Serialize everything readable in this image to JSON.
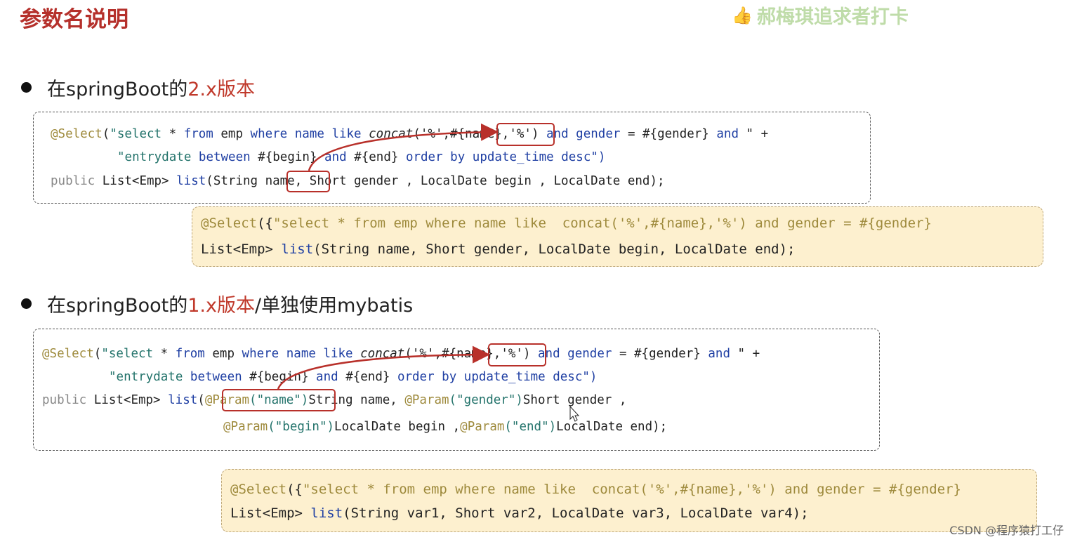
{
  "title": "参数名说明",
  "watermark": "郝梅琪追求者打卡",
  "bullet1": {
    "prefix": "在springBoot的",
    "highlight": "2.x版本",
    "suffix": ""
  },
  "bullet2": {
    "prefix": "在springBoot的",
    "highlight": "1.x版本",
    "suffix": "/单独使用mybatis"
  },
  "code1": {
    "l1": {
      "a": "@Select",
      "b": "(",
      "c": "\"select ",
      "d": "* ",
      "e": "from ",
      "f": "emp ",
      "g": "where ",
      "h": "name ",
      "i": "like ",
      "j": "concat",
      "k": "('%',",
      "l": "#{name}",
      "m": ",'%') ",
      "n": "and ",
      "o": "gender ",
      "p": "= #{gender} ",
      "q": "and ",
      "r": "\" +"
    },
    "l2": {
      "a": "\"entrydate ",
      "b": "between ",
      "c": "#{begin} ",
      "d": "and ",
      "e": "#{end} ",
      "f": "order by ",
      "g": "update_time ",
      "h": "desc\")"
    },
    "l3": {
      "a": "public ",
      "b": "List<Emp> ",
      "c": "list",
      "d": "(String ",
      "e": "name,",
      "f": " Short gender , LocalDate begin , LocalDate end);"
    }
  },
  "ycode1": {
    "l1": {
      "a": "@Select",
      "b": "({",
      "c": "\"select * from emp where name like  concat('%',#{name},'%') and gender = #{gender}"
    },
    "l2": {
      "a": "List<Emp> ",
      "b": "list",
      "c": "(String name, Short gender, LocalDate begin, LocalDate end);"
    }
  },
  "code2": {
    "l1": {
      "a": "@Select",
      "b": "(",
      "c": "\"select ",
      "d": "* ",
      "e": "from ",
      "f": "emp ",
      "g": "where ",
      "h": "name ",
      "i": "like ",
      "j": "concat",
      "k": "('%',",
      "l": "#{name}",
      "m": ",'%') ",
      "n": "and ",
      "o": "gender ",
      "p": "= #{gender} ",
      "q": "and ",
      "r": "\" +"
    },
    "l2": {
      "a": "\"entrydate ",
      "b": "between ",
      "c": "#{begin} ",
      "d": "and ",
      "e": "#{end} ",
      "f": "order by ",
      "g": "update_time ",
      "h": "desc\")"
    },
    "l3": {
      "a": "public ",
      "b": "List<Emp> ",
      "c": "list",
      "d": "(",
      "e": "@Param",
      "f": "(\"name\")",
      "g": "String name, ",
      "h": "@Param",
      "i": "(\"gender\")",
      "j": "Short gender ,"
    },
    "l4": {
      "a": "@Param",
      "b": "(\"begin\")",
      "c": "LocalDate begin ,",
      "d": "@Param",
      "e": "(\"end\")",
      "f": "LocalDate end);"
    }
  },
  "ycode2": {
    "l1": {
      "a": "@Select",
      "b": "({",
      "c": "\"select * from emp where name like  concat('%',#{name},'%') and gender = #{gender}"
    },
    "l2": {
      "a": "List<Emp> ",
      "b": "list",
      "c": "(String var1, Short var2, LocalDate var3, LocalDate var4);"
    }
  },
  "footer": "CSDN @程序猿打工仔",
  "colors": {
    "title": "#b5302b",
    "highlight_border": "#b8302a",
    "annotation": "#9e8a3c",
    "keyword": "#1f3fa3",
    "string": "#23736b",
    "yellow_bg": "#fdf0cf"
  }
}
